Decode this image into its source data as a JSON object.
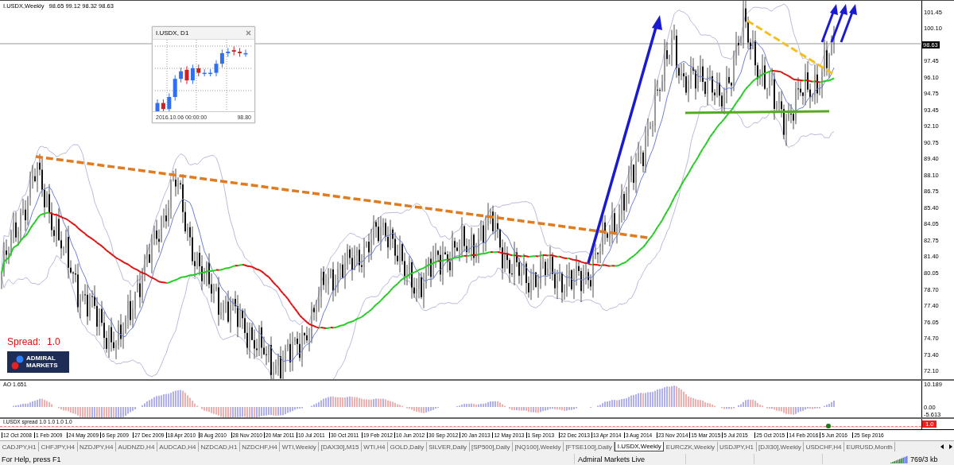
{
  "chart_header": {
    "symbol": "I.USDX,Weekly",
    "ohlc": "98.65 99.12 98.32 98.63"
  },
  "inset": {
    "title": "I.USDX, D1",
    "date": "2016.10.06 00:00:00",
    "price": "98.80"
  },
  "spread_label": {
    "label": "Spread:",
    "value": "1.0"
  },
  "logo": {
    "lines": [
      "ADMIRAL",
      "MARKETS"
    ]
  },
  "price_axis": {
    "labels": [
      "101.45",
      "100.10",
      "97.45",
      "96.10",
      "94.75",
      "93.45",
      "92.10",
      "90.75",
      "89.40",
      "88.10",
      "86.75",
      "85.40",
      "84.05",
      "82.75",
      "81.40",
      "80.05",
      "78.70",
      "77.40",
      "76.05",
      "74.70",
      "73.40",
      "72.10"
    ],
    "current_price": "98.63"
  },
  "indicator": {
    "label": "AO 1.651",
    "axis": [
      "10.189",
      "0.00",
      "-5.613"
    ]
  },
  "spread_pane": {
    "label": "I.USDX spread 1.0 1.0 1.0 1.0",
    "value": "1.0"
  },
  "dates": [
    "12 Oct 2008",
    "1 Feb 2009",
    "24 May 2009",
    "6 Sep 2009",
    "27 Dec 2009",
    "18 Apr 2010",
    "8 Aug 2010",
    "28 Nov 2010",
    "20 Mar 2011",
    "10 Jul 2011",
    "30 Oct 2011",
    "19 Feb 2012",
    "10 Jun 2012",
    "30 Sep 2012",
    "20 Jan 2013",
    "12 May 2013",
    "1 Sep 2013",
    "22 Dec 2013",
    "13 Apr 2014",
    "3 Aug 2014",
    "23 Nov 2014",
    "15 Mar 2015",
    "5 Jul 2015",
    "25 Oct 2015",
    "14 Feb 2016",
    "5 Jun 2016",
    "25 Sep 2016"
  ],
  "tabs": [
    {
      "label": "CADJPY,H1",
      "selected": false
    },
    {
      "label": "CHFJPY,H4",
      "selected": false
    },
    {
      "label": "NZDJPY,H4",
      "selected": false
    },
    {
      "label": "AUDNZD,H4",
      "selected": false
    },
    {
      "label": "AUDCAD,H4",
      "selected": false
    },
    {
      "label": "NZDCAD,H1",
      "selected": false
    },
    {
      "label": "NZDCHF,H4",
      "selected": false
    },
    {
      "label": "WTI,Weekly",
      "selected": false
    },
    {
      "label": "[DAX30],M15",
      "selected": false
    },
    {
      "label": "WTI,H4",
      "selected": false
    },
    {
      "label": "GOLD,Daily",
      "selected": false
    },
    {
      "label": "SILVER,Daily",
      "selected": false
    },
    {
      "label": "[SP500],Daily",
      "selected": false
    },
    {
      "label": "[NQ100],Weekly",
      "selected": false
    },
    {
      "label": "[FTSE100],Daily",
      "selected": false
    },
    {
      "label": "I.USDX,Weekly",
      "selected": true
    },
    {
      "label": "EURCZK,Weekly",
      "selected": false
    },
    {
      "label": "USDJPY,H1",
      "selected": false
    },
    {
      "label": "[DJI30],Weekly",
      "selected": false
    },
    {
      "label": "USDCHF,H4",
      "selected": false
    },
    {
      "label": "EURUSD,Month",
      "selected": false
    }
  ],
  "status_bar": {
    "help": "For Help, press F1",
    "server": "Admiral Markets Live",
    "traffic": "769/3 kb"
  }
}
